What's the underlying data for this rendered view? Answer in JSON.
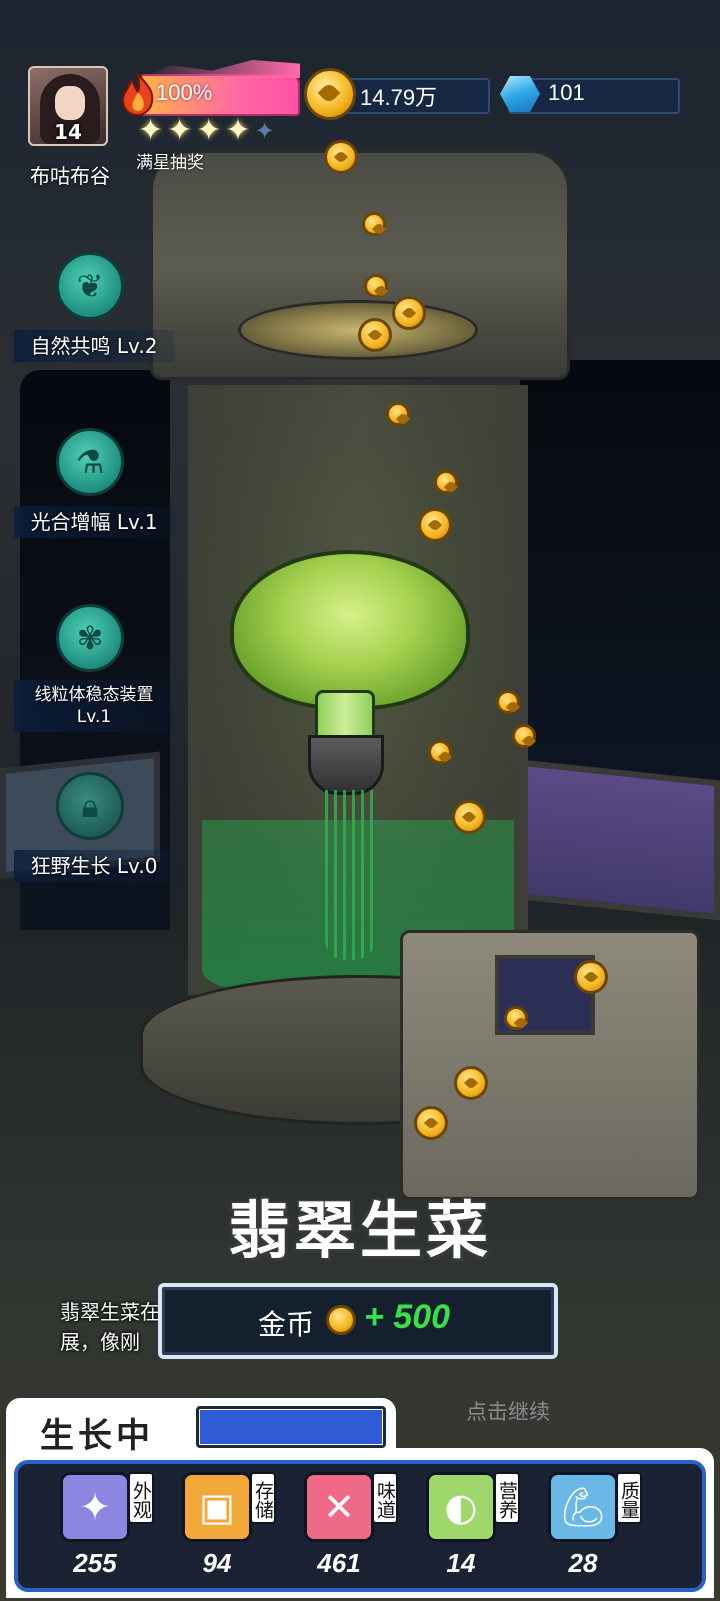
{
  "player": {
    "level": "14",
    "name": "布咕布谷"
  },
  "energy": {
    "percent_text": "100%",
    "stars_filled": 4,
    "stars_total": 5,
    "star_lottery_label": "满星抽奖"
  },
  "currency": {
    "gold": "14.79万",
    "gems": "101"
  },
  "skills": [
    {
      "label": "自然共鸣 Lv.2",
      "icon": "leaf-head-icon",
      "locked": false
    },
    {
      "label": "光合增幅 Lv.1",
      "icon": "flask-icon",
      "locked": false
    },
    {
      "label_line1": "线粒体稳态装置",
      "label_line2": "Lv.1",
      "icon": "plant-burst-icon",
      "locked": false
    },
    {
      "label": "狂野生长 Lv.0",
      "icon": "lock-icon",
      "locked": true
    }
  ],
  "vegetable": {
    "name": "翡翠生菜",
    "desc_line1": "翡翠生菜在自然共鸣的引导下完成进化，叶片更丰润舒",
    "desc_line2": "展，像刚"
  },
  "reward": {
    "label": "金币",
    "amount": "+ 500"
  },
  "continue_hint": "点击继续",
  "growth": {
    "label": "生长中",
    "progress": 1.0,
    "bar_color": "#2f5bd6"
  },
  "attributes": [
    {
      "tag": "外观",
      "value": "255",
      "icon": "sparkle-icon",
      "color": "#8c86e0"
    },
    {
      "tag": "存储",
      "value": "94",
      "icon": "storage-box-icon",
      "color": "#f2a93a"
    },
    {
      "tag": "味道",
      "value": "461",
      "icon": "fork-knife-icon",
      "color": "#ee6a86"
    },
    {
      "tag": "营养",
      "value": "14",
      "icon": "lime-icon",
      "color": "#9fd86a"
    },
    {
      "tag": "质量",
      "value": "28",
      "icon": "muscle-arm-icon",
      "color": "#6ab8e6"
    }
  ]
}
